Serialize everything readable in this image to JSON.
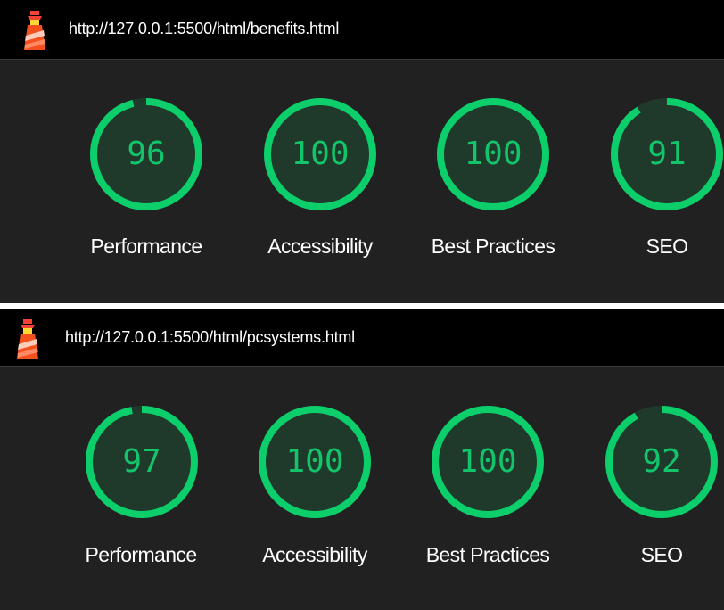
{
  "colors": {
    "pass": "#0cce6b",
    "track": "#1f3a2b",
    "panel": "#212121",
    "topbar": "#000000",
    "score_text": "#12c46a"
  },
  "reports": [
    {
      "url": "http://127.0.0.1:5500/html/benefits.html",
      "logo_icon": "lighthouse-icon",
      "categories": [
        {
          "score": "96",
          "value": 96,
          "label": "Performance"
        },
        {
          "score": "100",
          "value": 100,
          "label": "Accessibility"
        },
        {
          "score": "100",
          "value": 100,
          "label": "Best Practices"
        },
        {
          "score": "91",
          "value": 91,
          "label": "SEO"
        }
      ]
    },
    {
      "url": "http://127.0.0.1:5500/html/pcsystems.html",
      "logo_icon": "lighthouse-icon",
      "categories": [
        {
          "score": "97",
          "value": 97,
          "label": "Performance"
        },
        {
          "score": "100",
          "value": 100,
          "label": "Accessibility"
        },
        {
          "score": "100",
          "value": 100,
          "label": "Best Practices"
        },
        {
          "score": "92",
          "value": 92,
          "label": "SEO"
        }
      ]
    }
  ]
}
